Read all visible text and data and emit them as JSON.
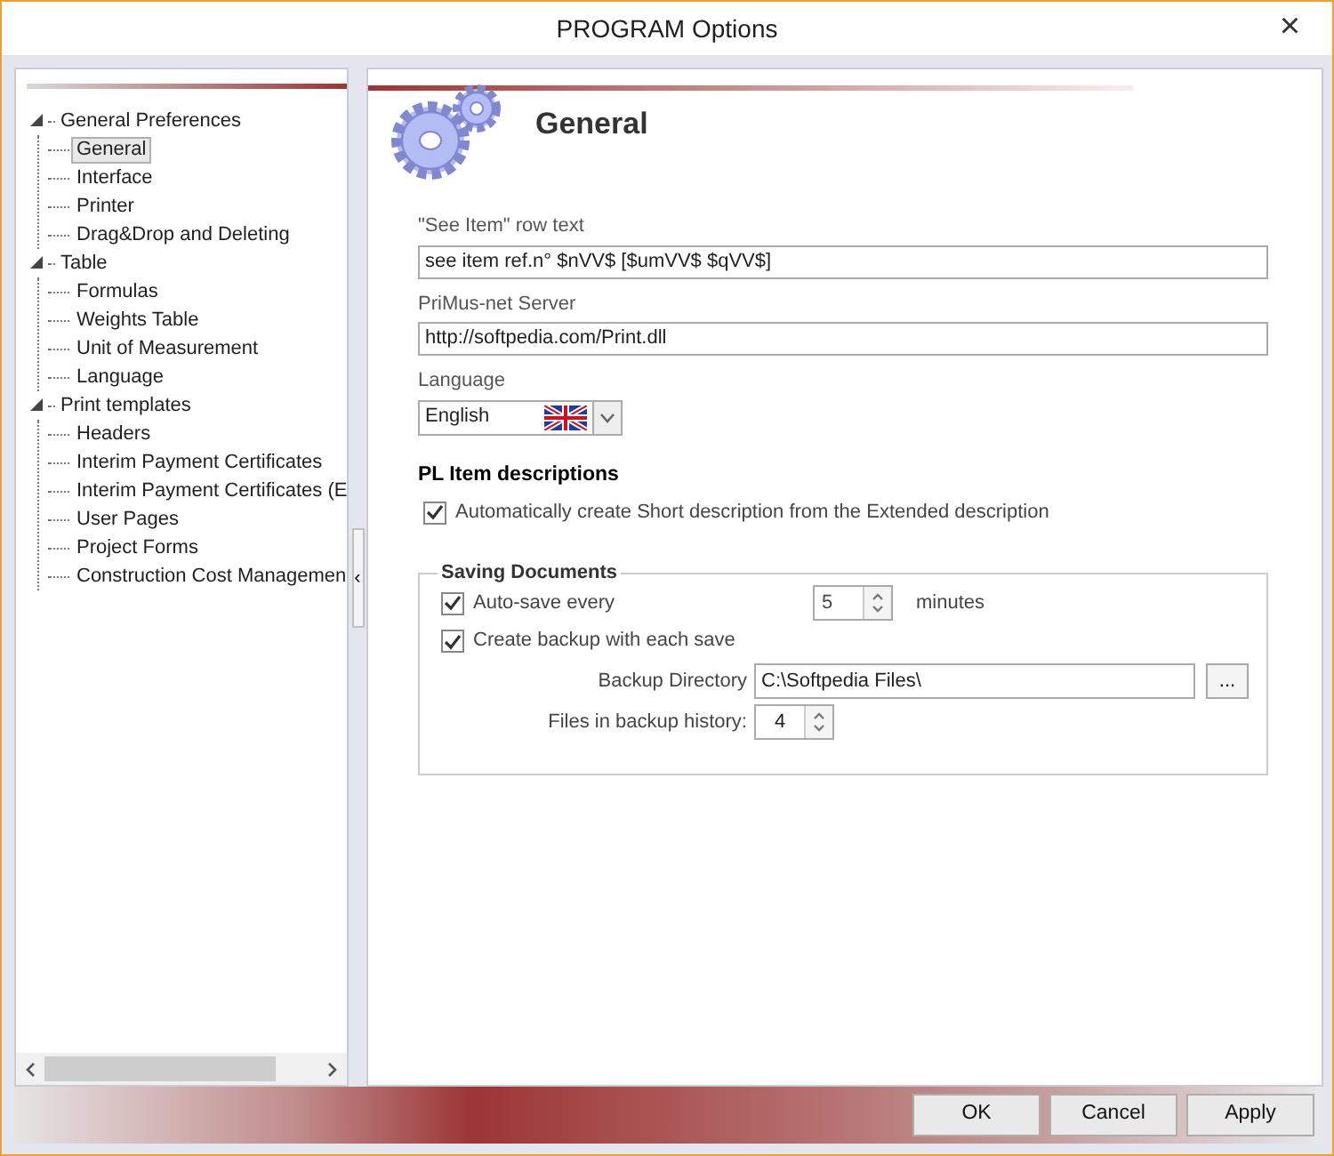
{
  "window": {
    "title": "PROGRAM Options",
    "close": "×"
  },
  "tree": [
    {
      "label": "General Preferences",
      "expanded": true,
      "selected": false,
      "children": [
        {
          "label": "General",
          "selected": true
        },
        {
          "label": "Interface",
          "selected": false
        },
        {
          "label": "Printer",
          "selected": false
        },
        {
          "label": "Drag&Drop and Deleting",
          "selected": false
        }
      ]
    },
    {
      "label": "Table",
      "expanded": true,
      "selected": false,
      "children": [
        {
          "label": "Formulas",
          "selected": false
        },
        {
          "label": "Weights Table",
          "selected": false
        },
        {
          "label": "Unit of Measurement",
          "selected": false
        },
        {
          "label": "Language",
          "selected": false
        }
      ]
    },
    {
      "label": "Print templates",
      "expanded": true,
      "selected": false,
      "children": [
        {
          "label": "Headers",
          "selected": false
        },
        {
          "label": "Interim Payment Certificates",
          "selected": false
        },
        {
          "label": "Interim Payment Certificates (E",
          "selected": false
        },
        {
          "label": "User Pages",
          "selected": false
        },
        {
          "label": "Project Forms",
          "selected": false
        },
        {
          "label": "Construction Cost Managemen",
          "selected": false
        }
      ]
    }
  ],
  "splitter": {
    "arrow": "‹"
  },
  "page": {
    "title": "General",
    "see_item": {
      "label": "\"See Item\" row text",
      "value": "see item ref.n° $nVV$ [$umVV$ $qVV$]"
    },
    "server": {
      "label": "PriMus-net Server",
      "value": "http://softpedia.com/Print.dll"
    },
    "language": {
      "label": "Language",
      "value": "English"
    },
    "descriptions": {
      "title": "PL Item descriptions",
      "auto_create": {
        "label": "Automatically create Short description from the Extended description",
        "checked": true
      }
    },
    "saving": {
      "title": "Saving Documents",
      "auto_save": {
        "label": "Auto-save every",
        "checked": true,
        "value": "5",
        "unit": "minutes"
      },
      "backup": {
        "label": "Create backup with each save",
        "checked": true
      },
      "directory": {
        "label": "Backup Directory",
        "value": "C:\\Softpedia Files\\",
        "browse": "..."
      },
      "history": {
        "label": "Files in backup history:",
        "value": "4"
      }
    }
  },
  "buttons": [
    "OK",
    "Cancel",
    "Apply"
  ]
}
